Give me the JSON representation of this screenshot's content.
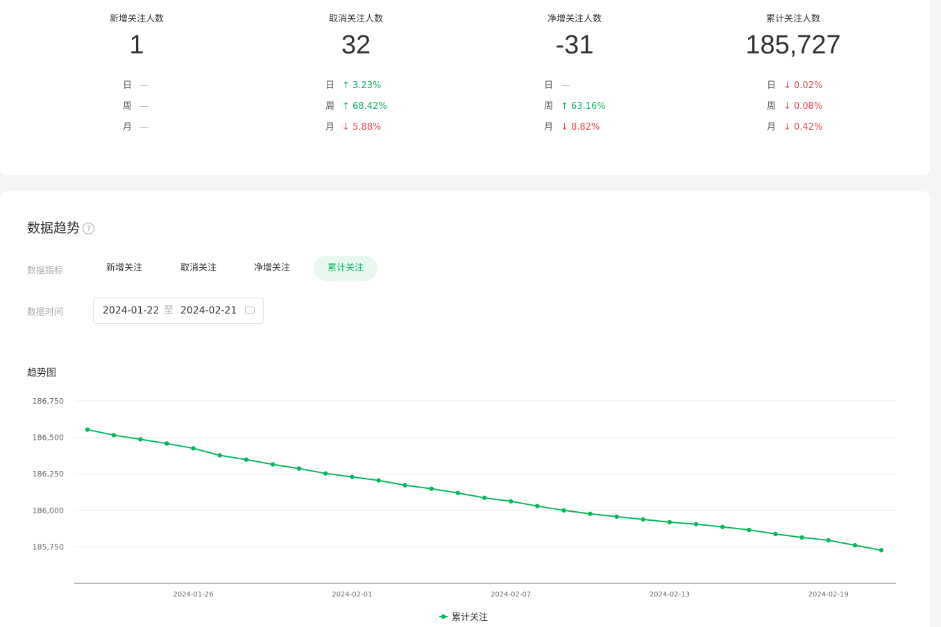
{
  "stats": [
    {
      "label": "新增关注人数",
      "value": "1",
      "rows": [
        {
          "k": "日",
          "v": "—",
          "dir": "none"
        },
        {
          "k": "周",
          "v": "—",
          "dir": "none"
        },
        {
          "k": "月",
          "v": "—",
          "dir": "none"
        }
      ]
    },
    {
      "label": "取消关注人数",
      "value": "32",
      "rows": [
        {
          "k": "日",
          "v": "↑ 3.23%",
          "dir": "up"
        },
        {
          "k": "周",
          "v": "↑ 68.42%",
          "dir": "up"
        },
        {
          "k": "月",
          "v": "↓ 5.88%",
          "dir": "down"
        }
      ]
    },
    {
      "label": "净增关注人数",
      "value": "-31",
      "rows": [
        {
          "k": "日",
          "v": "—",
          "dir": "none"
        },
        {
          "k": "周",
          "v": "↑ 63.16%",
          "dir": "up"
        },
        {
          "k": "月",
          "v": "↓ 8.82%",
          "dir": "down"
        }
      ]
    },
    {
      "label": "累计关注人数",
      "value": "185,727",
      "rows": [
        {
          "k": "日",
          "v": "↓ 0.02%",
          "dir": "down"
        },
        {
          "k": "周",
          "v": "↓ 0.08%",
          "dir": "down"
        },
        {
          "k": "月",
          "v": "↓ 0.42%",
          "dir": "down"
        }
      ]
    }
  ],
  "trend": {
    "title": "数据趋势",
    "help": "?",
    "metric_label": "数据指标",
    "tabs": [
      "新增关注",
      "取消关注",
      "净增关注",
      "累计关注"
    ],
    "active_tab": 3,
    "time_label": "数据时间",
    "date_start": "2024-01-22",
    "date_sep": "至",
    "date_end": "2024-02-21",
    "chart_title": "趋势图"
  },
  "colors": {
    "accent": "#07b85c",
    "up": "#07b85c",
    "down": "#e5484d"
  },
  "chart_data": {
    "type": "line",
    "x_start": "2024-01-22",
    "x": [
      "2024-01-22",
      "2024-01-23",
      "2024-01-24",
      "2024-01-25",
      "2024-01-26",
      "2024-01-27",
      "2024-01-28",
      "2024-01-29",
      "2024-01-30",
      "2024-01-31",
      "2024-02-01",
      "2024-02-02",
      "2024-02-03",
      "2024-02-04",
      "2024-02-05",
      "2024-02-06",
      "2024-02-07",
      "2024-02-08",
      "2024-02-09",
      "2024-02-10",
      "2024-02-11",
      "2024-02-12",
      "2024-02-13",
      "2024-02-14",
      "2024-02-15",
      "2024-02-16",
      "2024-02-17",
      "2024-02-18",
      "2024-02-19",
      "2024-02-20",
      "2024-02-21"
    ],
    "series": [
      {
        "name": "累计关注",
        "values": [
          186553,
          186515,
          186487,
          186458,
          186425,
          186377,
          186348,
          186315,
          186286,
          186253,
          186229,
          186205,
          186172,
          186148,
          186119,
          186086,
          186062,
          186029,
          186000,
          185976,
          185957,
          185938,
          185919,
          185905,
          185886,
          185866,
          185838,
          185814,
          185795,
          185761,
          185727
        ]
      }
    ],
    "yticks": [
      "186,750",
      "186,500",
      "186,250",
      "186,000",
      "185,750"
    ],
    "ytick_values": [
      186750,
      186500,
      186250,
      186000,
      185750
    ],
    "xticks": [
      "2024-01-26",
      "2024-02-01",
      "2024-02-07",
      "2024-02-13",
      "2024-02-19"
    ],
    "xtick_index": [
      4,
      10,
      16,
      22,
      28
    ],
    "ylim": [
      185500,
      186750
    ],
    "legend": "bottom-center",
    "grid": true
  }
}
